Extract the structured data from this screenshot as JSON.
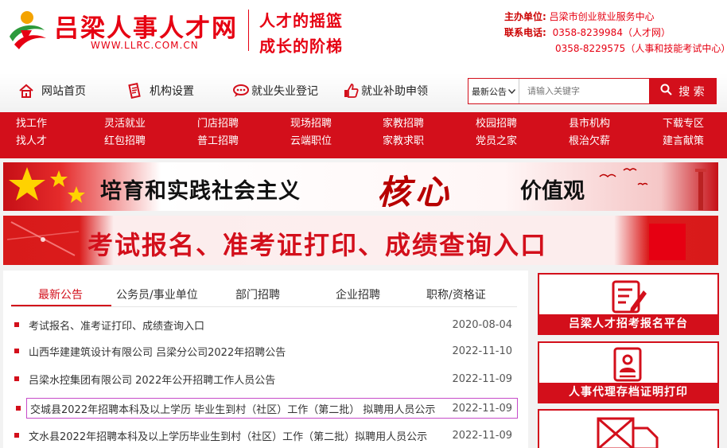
{
  "header": {
    "site_name": "吕梁人事人才网",
    "site_url": "WWW.LLRC.COM.CN",
    "slogan_1": "人才的摇篮",
    "slogan_2": "成长的阶梯",
    "host_label": "主办单位:",
    "host_value": "吕梁市创业就业服务中心",
    "phone_label": "联系电话:",
    "phone_1": "0358-8239984（人才网）",
    "phone_2": "0358-8229575（人事和技能考试中心）"
  },
  "topnav": {
    "items": [
      {
        "label": "网站首页",
        "icon": "home-icon"
      },
      {
        "label": "机构设置",
        "icon": "document-icon"
      },
      {
        "label": "就业失业登记",
        "icon": "chat-icon"
      },
      {
        "label": "就业补助申领",
        "icon": "thumbs-up-icon"
      }
    ]
  },
  "search": {
    "select_value": "最新公告",
    "placeholder": "请输入关键字",
    "button_label": "搜 索"
  },
  "rednav": {
    "columns": [
      [
        "找工作",
        "找人才"
      ],
      [
        "灵活就业",
        "红包招聘"
      ],
      [
        "门店招聘",
        "普工招聘"
      ],
      [
        "现场招聘",
        "云端职位"
      ],
      [
        "家教招聘",
        "家教求职"
      ],
      [
        "校园招聘",
        "党员之家"
      ],
      [
        "县市机构",
        "根治欠薪"
      ],
      [
        "下载专区",
        "建言献策"
      ]
    ]
  },
  "banner1": {
    "text": "培育和实践社会主义",
    "accent": "核心",
    "tail": "价值观"
  },
  "banner2": {
    "text": "考试报名、准考证打印、成绩查询入口"
  },
  "news": {
    "tabs": [
      "最新公告",
      "公务员/事业单位",
      "部门招聘",
      "企业招聘",
      "职称/资格证"
    ],
    "rows": [
      {
        "title": "考试报名、准考证打印、成绩查询入口",
        "date": "2020-08-04"
      },
      {
        "title": "山西华建建筑设计有限公司 吕梁分公司2022年招聘公告",
        "date": "2022-11-10"
      },
      {
        "title": "吕梁水控集团有限公司 2022年公开招聘工作人员公告",
        "date": "2022-11-09"
      },
      {
        "title": "交城县2022年招聘本科及以上学历 毕业生到村（社区）工作（第二批） 拟聘用人员公示",
        "date": "2022-11-09"
      },
      {
        "title": "文水县2022年招聘本科及以上学历毕业生到村（社区）工作（第二批）拟聘用人员公示",
        "date": "2022-11-09"
      }
    ]
  },
  "cards": [
    {
      "caption": "吕梁人才招考报名平台",
      "icon": "signup-form-icon"
    },
    {
      "caption": "人事代理存档证明打印",
      "icon": "certificate-icon"
    },
    {
      "caption": "",
      "icon": "delivery-truck-icon"
    }
  ]
}
